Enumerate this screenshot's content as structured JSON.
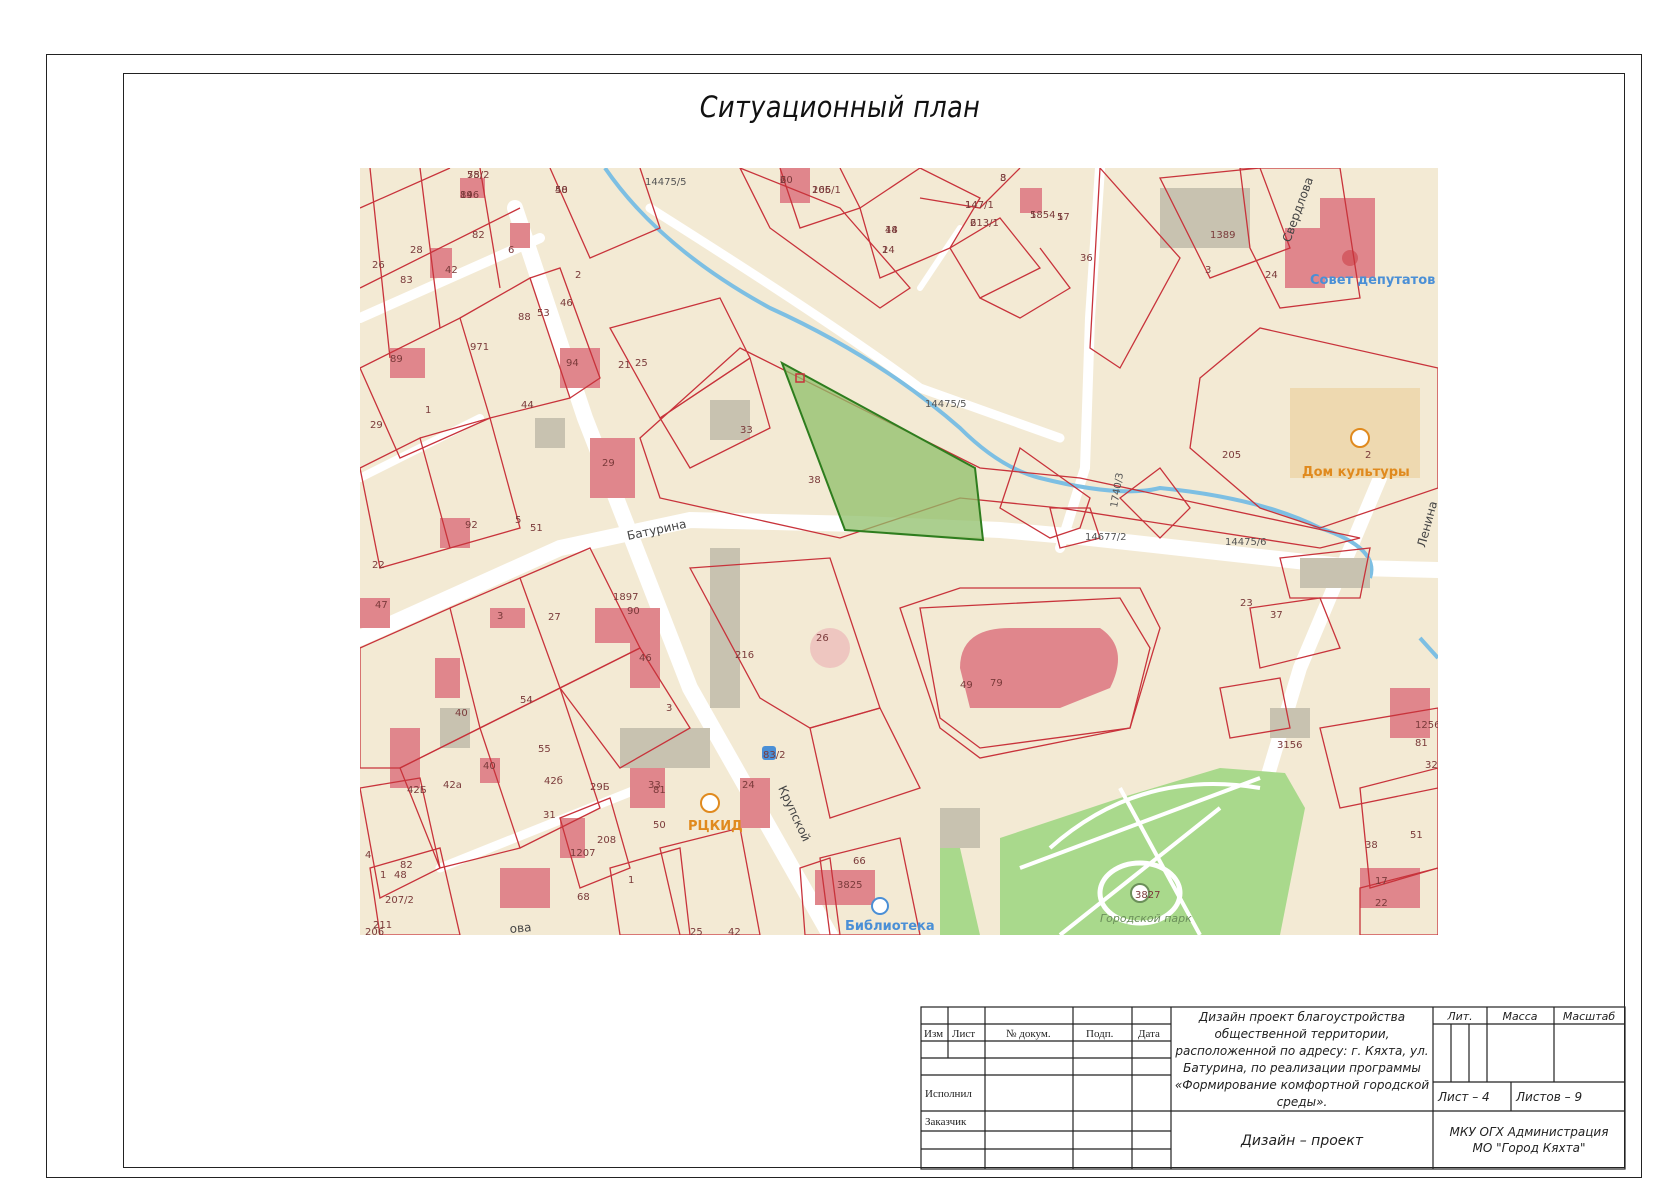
{
  "sheet": {
    "title": "Ситуационный план"
  },
  "map": {
    "streets": [
      "Батурина",
      "Крупской",
      "Свердлова",
      "Ленина",
      "ова"
    ],
    "pois": [
      {
        "label": "Совет депутатов",
        "color": "#4a8fd6"
      },
      {
        "label": "Дом культуры",
        "color": "#e08a1e"
      },
      {
        "label": "РЦКИД",
        "color": "#e08a1e"
      },
      {
        "label": "Библиотека",
        "color": "#4a8fd6"
      },
      {
        "label": "Городской парк",
        "color": "#6b8f5a"
      }
    ],
    "parcel_labels": [
      "14475/5",
      "14475/5",
      "14475/6",
      "14677/2",
      "1740/3"
    ],
    "house_numbers": [
      "55",
      "84",
      "48",
      "20",
      "165",
      "3",
      "1",
      "6",
      "5",
      "57",
      "18",
      "2",
      "82",
      "28",
      "42",
      "26",
      "83",
      "6",
      "2",
      "46",
      "53",
      "88",
      "971",
      "89",
      "36",
      "1389",
      "24",
      "3",
      "25",
      "21",
      "33",
      "38",
      "94",
      "1",
      "44",
      "29",
      "29",
      "92",
      "5",
      "51",
      "22",
      "47",
      "205",
      "2",
      "1897",
      "90",
      "3",
      "27",
      "46",
      "216",
      "26",
      "49",
      "79",
      "23",
      "37",
      "54",
      "3",
      "40",
      "55",
      "81",
      "1256",
      "3156",
      "32",
      "42а",
      "42Б",
      "42б",
      "31",
      "33",
      "24",
      "83/2",
      "50",
      "208",
      "29Б",
      "40",
      "38",
      "51",
      "17",
      "22",
      "66",
      "3825",
      "3827",
      "4",
      "1",
      "48",
      "82",
      "206",
      "211",
      "25",
      "42",
      "1207",
      "68",
      "1",
      "81",
      "207/2",
      "78/2",
      "196",
      "50",
      "6",
      "206/1",
      "8",
      "147/1",
      "213/1",
      "1854",
      "1",
      "44",
      "14"
    ],
    "selected_area_color": "#8fbf6a",
    "parcel_line_color": "#c8333b",
    "building_color": "#e0868c",
    "park_color": "#a9d98c",
    "river_color": "#7dbfe3"
  },
  "stamp": {
    "headers": [
      "Изм",
      "Лист",
      "№ докум.",
      "Подп.",
      "Дата"
    ],
    "roles": [
      "Исполнил",
      "Заказчик"
    ],
    "project_title_lines": [
      "Дизайн проект благоустройства",
      "общественной территории,",
      "расположенной по адресу: г. Кяхта, ул.",
      "Батурина, по реализации программы",
      "«Формирование комфортной городской",
      "среды»."
    ],
    "subtitle": "Дизайн – проект",
    "col_lit": "Лит.",
    "col_mass": "Масса",
    "col_scale": "Масштаб",
    "sheet_label": "Лист – 4",
    "sheets_label": "Листов – 9",
    "organization_line1": "МКУ ОГХ Администрация",
    "organization_line2": "МО \"Город Кяхта\""
  }
}
